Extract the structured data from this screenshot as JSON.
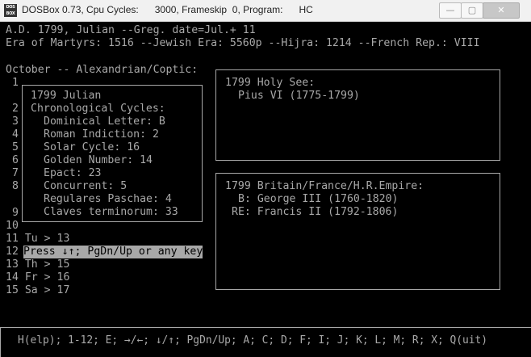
{
  "window": {
    "icon_text": "DOS BOX",
    "title": "DOSBox 0.73, Cpu Cycles:      3000, Frameskip  0, Program:      HC",
    "minimize_glyph": "—",
    "maximize_glyph": "▢",
    "close_glyph": "✕"
  },
  "screen": {
    "line1": "A.D. 1799, Julian --Greg. date=Jul.+ 11",
    "line2": "Era of Martyrs: 1516 --Jewish Era: 5560p --Hijra: 1214 --French Rep.: VIII",
    "month_header": "October -- Alexandrian/Coptic:",
    "day_numbers": [
      "1",
      "2",
      "3",
      "4",
      "5",
      "6",
      "7",
      "8",
      "9",
      "10"
    ],
    "cycles_box": {
      "title": "1799 Julian",
      "subtitle": "Chronological Cycles:",
      "items": [
        "Dominical Letter: B",
        "Roman Indiction: 2",
        "Solar Cycle: 16",
        "Golden Number: 14",
        "Epact: 23",
        "Concurrent: 5",
        "Regulares Paschae: 4",
        "Claves terminorum: 33"
      ]
    },
    "days": [
      "11 Tu > 13",
      "12",
      "13 Th > 15",
      "14 Fr > 16",
      "15 Sa > 17"
    ],
    "prompt": "Press ↓↑; PgDn/Up or any key",
    "holy_see": {
      "title": "1799 Holy See:",
      "line": "Pius VI (1775-1799)"
    },
    "rulers": {
      "title": "1799 Britain/France/H.R.Empire:",
      "lines": [
        "B: George III (1760-1820)",
        "RE: Francis II (1792-1806)"
      ]
    },
    "help": "H(elp); 1-12; E; →/←; ↓/↑; PgDn/Up; A; C; D; F; I; J; K; L; M; R; X; Q(uit)"
  }
}
